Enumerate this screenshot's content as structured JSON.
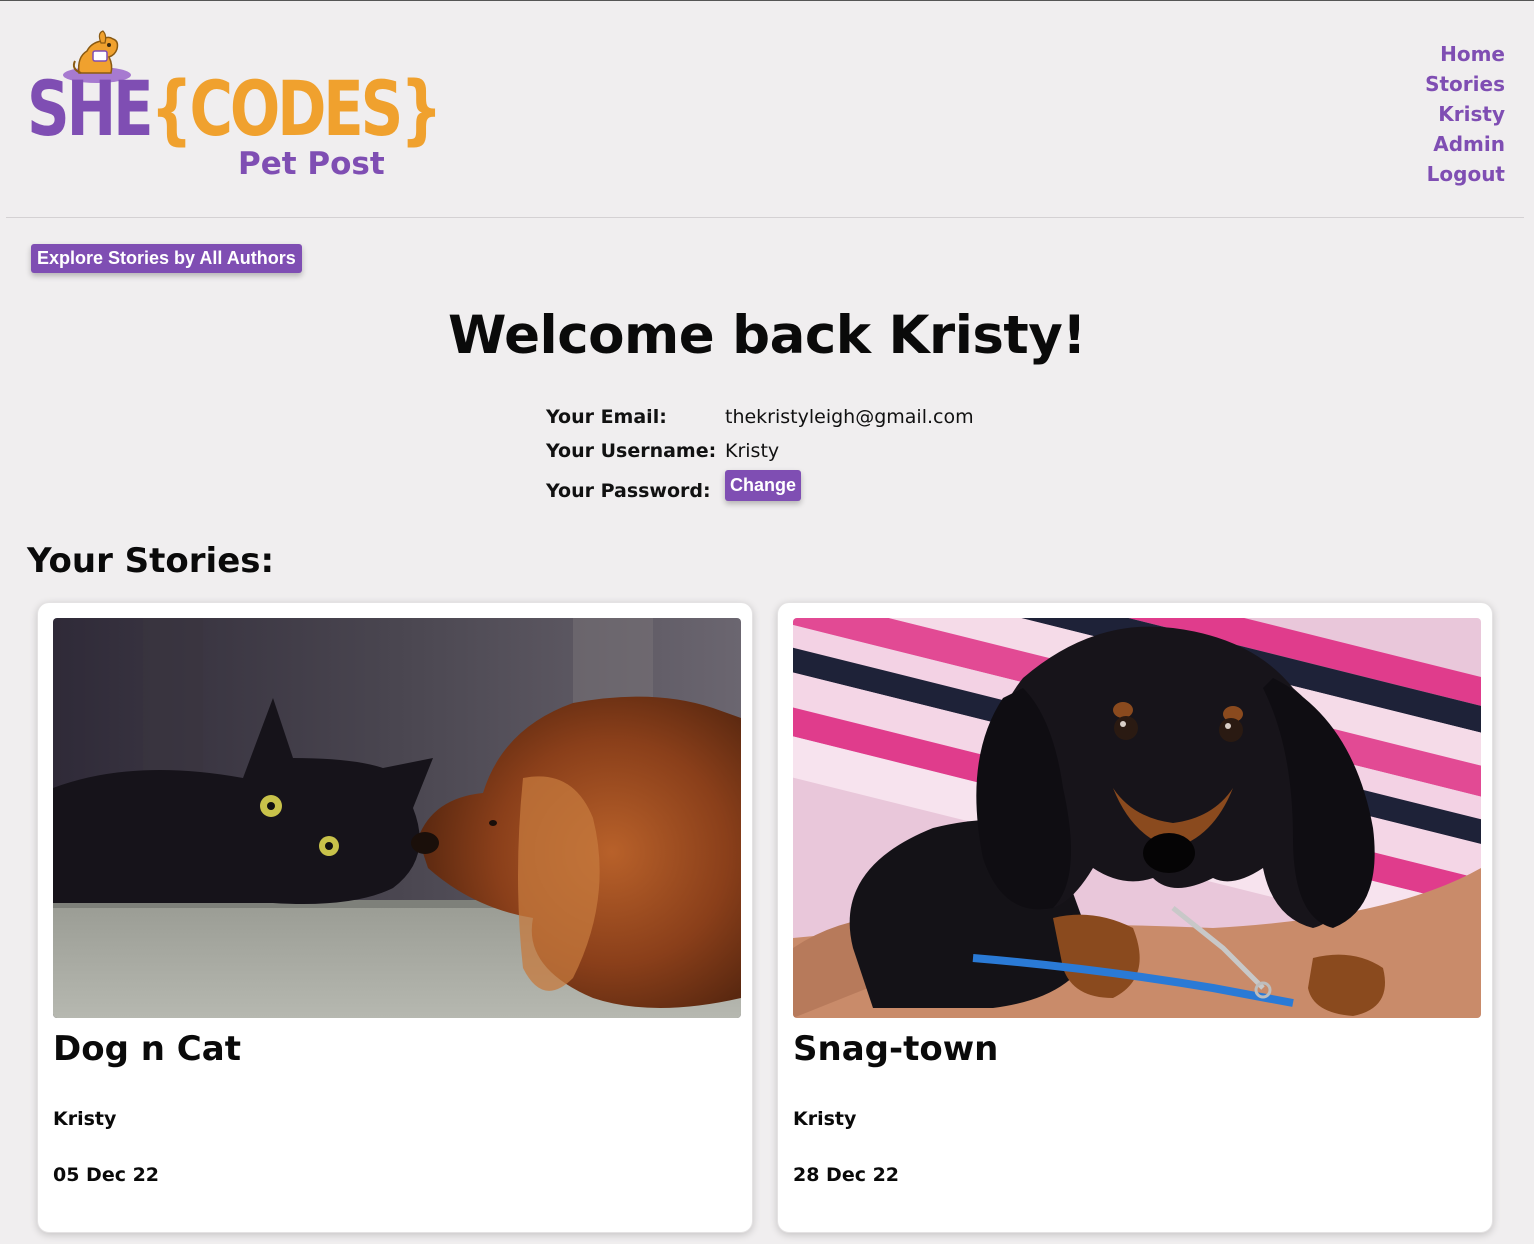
{
  "brand": {
    "she": "SHE",
    "codes": "{CODES}",
    "subtitle": "Pet Post"
  },
  "nav": {
    "items": [
      "Home",
      "Stories",
      "Kristy",
      "Admin",
      "Logout"
    ]
  },
  "explore_button": "Explore Stories by All Authors",
  "welcome_title": "Welcome back Kristy!",
  "profile": {
    "email_label": "Your Email:",
    "email_value": "thekristyleigh@gmail.com",
    "username_label": "Your Username:",
    "username_value": "Kristy",
    "password_label": "Your Password:",
    "change_button": "Change"
  },
  "stories_heading": "Your Stories:",
  "stories": [
    {
      "title": "Dog n Cat",
      "author": "Kristy",
      "date": "05 Dec 22",
      "image": "cat-and-dog-photo"
    },
    {
      "title": "Snag-town",
      "author": "Kristy",
      "date": "28 Dec 22",
      "image": "dachshund-puppy-photo"
    }
  ],
  "colors": {
    "accent_purple": "#7f4eb3",
    "accent_orange": "#f0a12e",
    "background": "#f0eeef"
  }
}
